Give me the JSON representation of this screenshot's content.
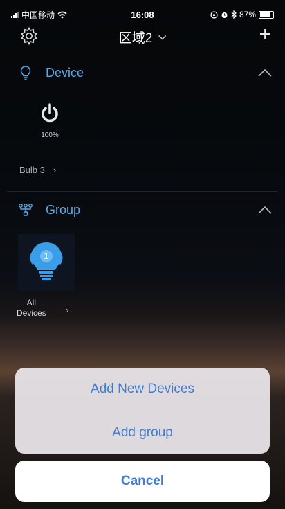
{
  "status_bar": {
    "carrier": "中国移动",
    "time": "16:08",
    "battery": "87%"
  },
  "nav": {
    "title": "区域2",
    "title_chevron": "⌄",
    "add_label": "+",
    "settings_icon": "gear-icon"
  },
  "device_section": {
    "title": "Device",
    "icon": "lightbulb-outline-icon",
    "devices": [
      {
        "name": "Bulb 3",
        "level": "100%",
        "icon": "power-icon"
      }
    ]
  },
  "group_section": {
    "title": "Group",
    "icon": "group-nodes-icon",
    "groups": [
      {
        "name_line1": "All",
        "name_line2": "Devices",
        "badge": "1",
        "icon": "bulb-filled-icon"
      }
    ]
  },
  "action_sheet": {
    "add_devices_label": "Add New Devices",
    "add_group_label": "Add group",
    "cancel_label": "Cancel"
  },
  "colors": {
    "accent": "#3f7cd4",
    "section_title": "#5aa8e6",
    "sheet_bg": "#e8e4e8"
  }
}
